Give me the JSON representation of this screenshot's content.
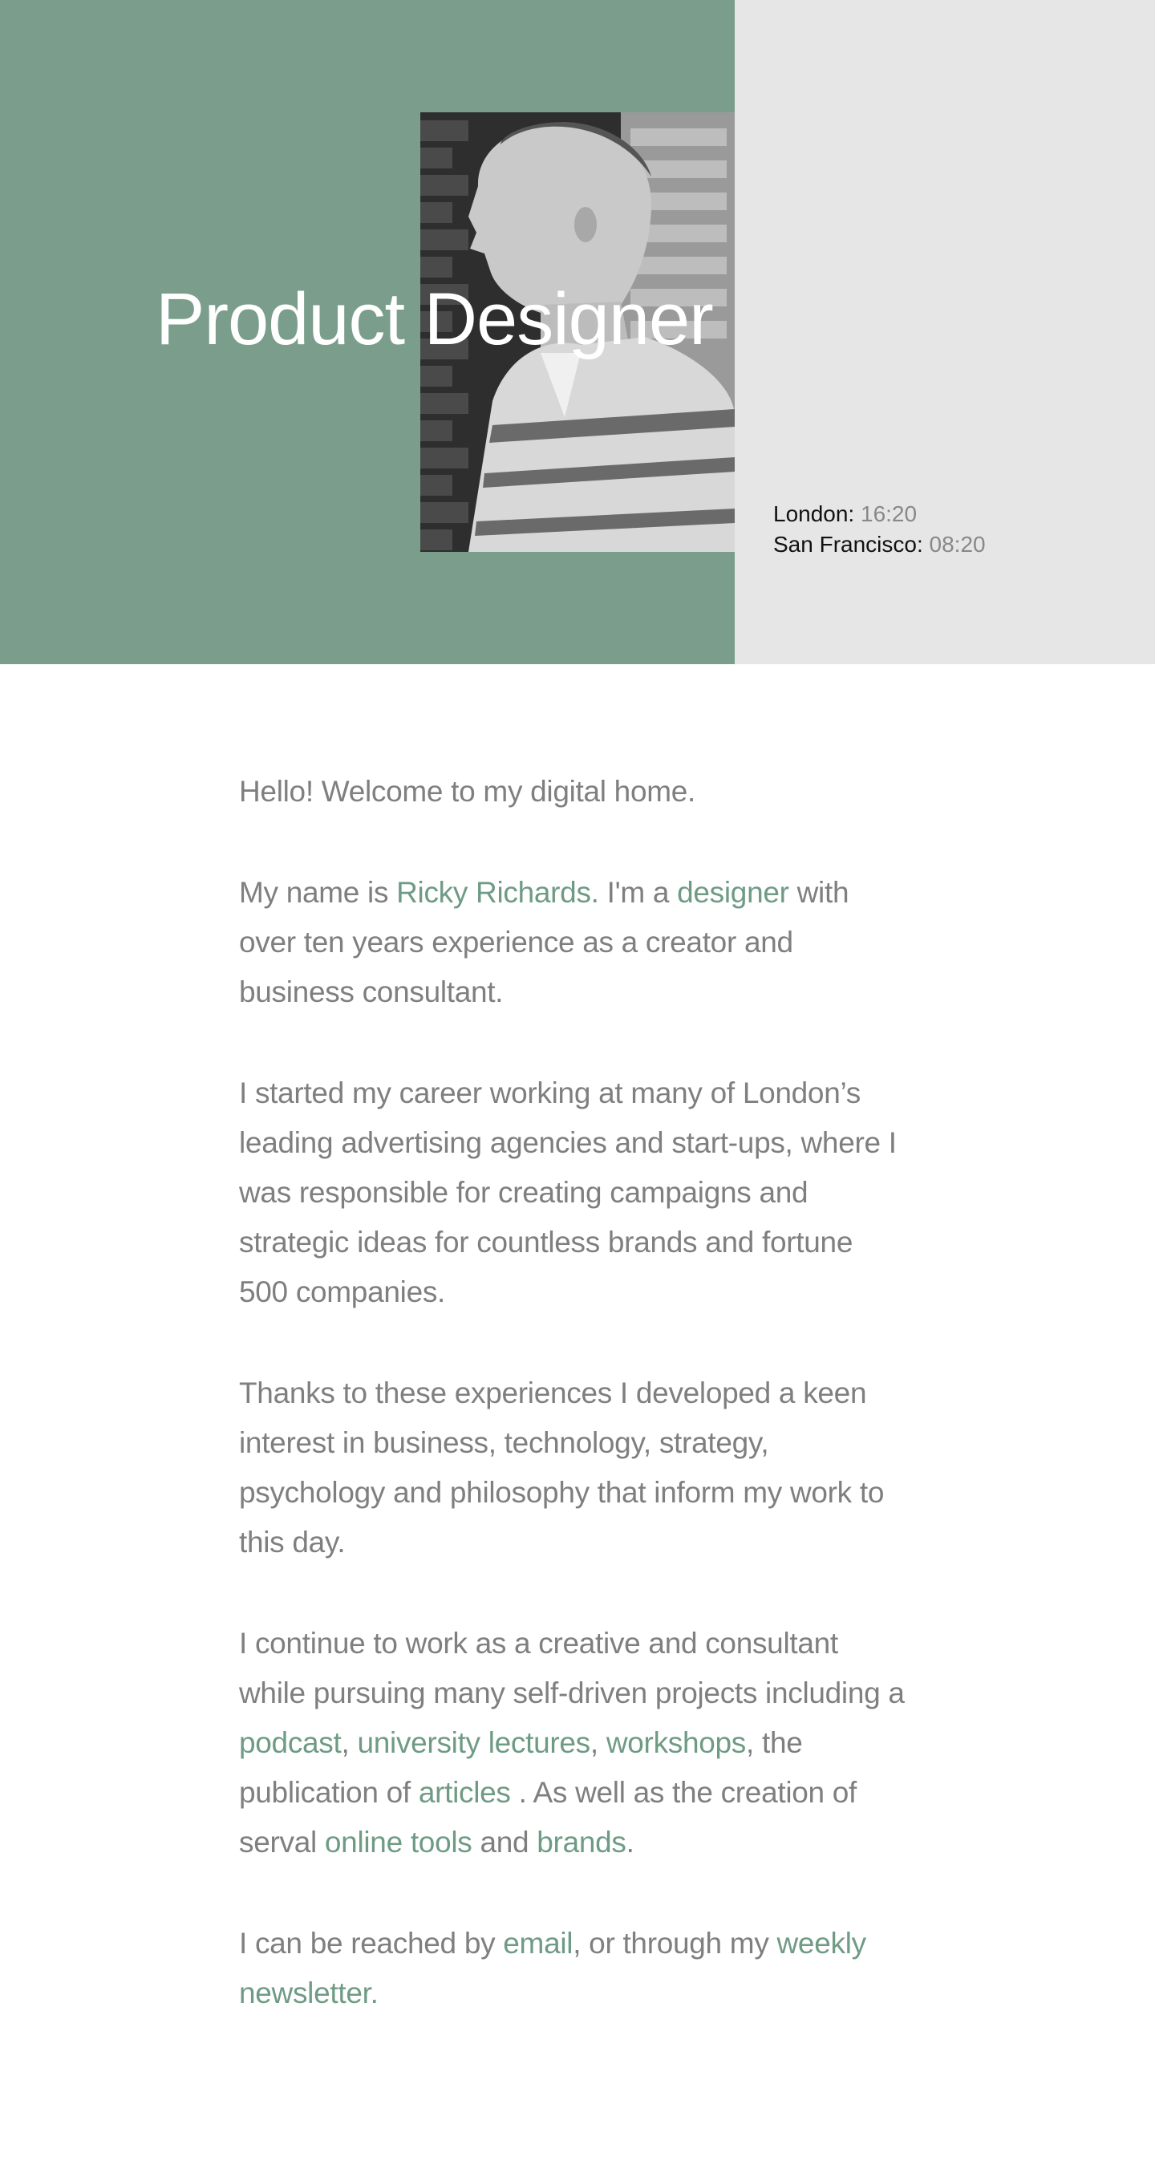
{
  "hero": {
    "title": "Product Designer",
    "clocks": [
      {
        "city": "London:",
        "time": "16:20"
      },
      {
        "city": "San Francisco:",
        "time": "08:20"
      }
    ]
  },
  "intro": {
    "greeting": "Hello! Welcome to my digital home.",
    "p1_before": "My name is ",
    "p1_name_link": "Ricky Richards.",
    "p1_mid": " I'm a ",
    "p1_designer_link": "designer",
    "p1_after": " with over ten years experience as a creator and business consultant.",
    "p2": "I started my career working at many of London’s leading advertising agencies and start-ups, where I was responsible for creating campaigns and strategic ideas for countless brands and fortune 500 companies.",
    "p3": "Thanks to these experiences I developed a keen interest in business, technology, strategy, psychology and philosophy that inform my work to this day.",
    "p4_before": "I continue to work as a creative and consultant while pursuing many self-driven projects including a ",
    "p4_podcast_link": "podcast",
    "p4_sep1": ", ",
    "p4_lectures_link": "university lectures",
    "p4_sep2": ", ",
    "p4_workshops_link": "workshops",
    "p4_mid": ", the publication of ",
    "p4_articles_link": "articles",
    "p4_mid2": " . As well as the creation of serval ",
    "p4_tools_link": "online tools",
    "p4_and": " and ",
    "p4_brands_link": "brands",
    "p4_end": ".",
    "p5_before": "I can be reached by ",
    "p5_email_link": "email",
    "p5_mid": ", or through my ",
    "p5_newsletter_link": "weekly newsletter."
  },
  "colors": {
    "hero_green": "#7a9e8b",
    "hero_gray": "#e6e6e6",
    "link_green": "#6f9b85",
    "body_text": "#7f7f7f"
  }
}
